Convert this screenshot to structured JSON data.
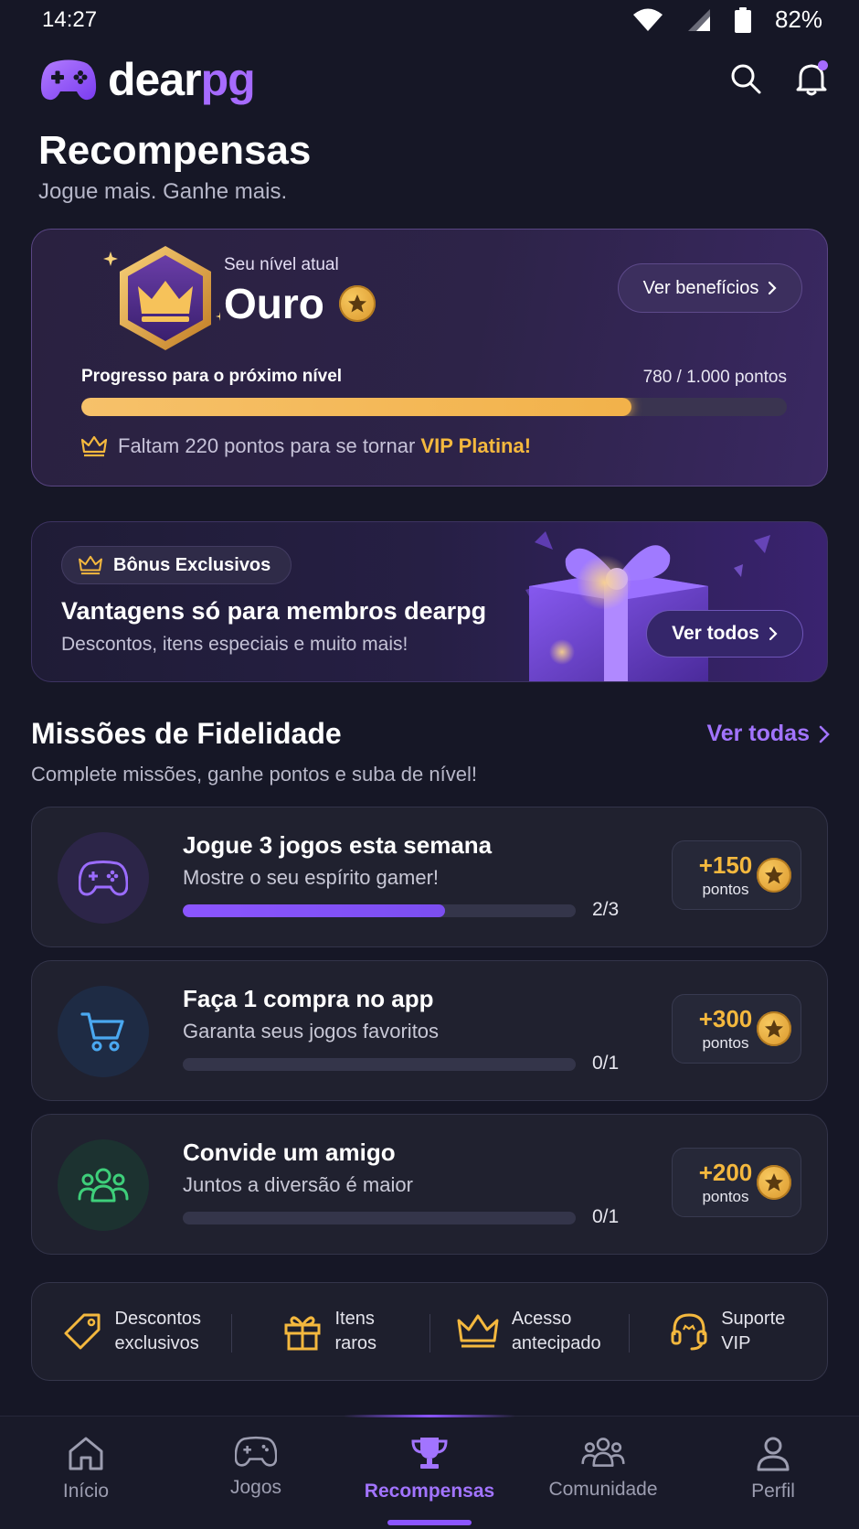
{
  "status_bar": {
    "time": "14:27",
    "battery": "82%"
  },
  "brand": {
    "name_part1": "dear",
    "name_part2": "pg"
  },
  "page": {
    "title": "Recompensas",
    "subtitle": "Jogue mais. Ganhe mais."
  },
  "level": {
    "label": "Seu nível atual",
    "name": "Ouro",
    "benefits_button": "Ver benefícios",
    "progress_label": "Progresso para o próximo nível",
    "progress_points": "780 / 1.000 pontos",
    "progress_fraction": 0.78,
    "remaining_text": "Faltam 220 pontos para se tornar ",
    "remaining_highlight": "VIP Platina!"
  },
  "bonus": {
    "tag": "Bônus Exclusivos",
    "title": "Vantagens só para membros dearpg",
    "subtitle": "Descontos, itens especiais e muito mais!",
    "button": "Ver todos"
  },
  "missions": {
    "title": "Missões de Fidelidade",
    "link": "Ver todas",
    "subtitle": "Complete missões, ganhe pontos e suba de nível!",
    "items": [
      {
        "title": "Jogue 3 jogos esta semana",
        "subtitle": "Mostre o seu espírito gamer!",
        "count": "2/3",
        "progress": 0.6667,
        "points": "+150",
        "points_label": "pontos",
        "icon": "gamepad-icon",
        "color": "#8b5cf6"
      },
      {
        "title": "Faça 1 compra no app",
        "subtitle": "Garanta seus jogos favoritos",
        "count": "0/1",
        "progress": 0,
        "points": "+300",
        "points_label": "pontos",
        "icon": "cart-icon",
        "color": "#4aa8f0"
      },
      {
        "title": "Convide um amigo",
        "subtitle": "Juntos a diversão é maior",
        "count": "0/1",
        "progress": 0,
        "points": "+200",
        "points_label": "pontos",
        "icon": "friends-icon",
        "color": "#3ecf7a"
      }
    ]
  },
  "perks": [
    {
      "line1": "Descontos",
      "line2": "exclusivos",
      "icon": "tag-icon"
    },
    {
      "line1": "Itens",
      "line2": "raros",
      "icon": "gift-icon"
    },
    {
      "line1": "Acesso",
      "line2": "antecipado",
      "icon": "crown-icon"
    },
    {
      "line1": "Suporte",
      "line2": "VIP",
      "icon": "headset-icon"
    }
  ],
  "tabs": [
    {
      "label": "Início",
      "icon": "home-icon"
    },
    {
      "label": "Jogos",
      "icon": "gamepad-icon"
    },
    {
      "label": "Recompensas",
      "icon": "trophy-icon",
      "active": true
    },
    {
      "label": "Comunidade",
      "icon": "community-icon"
    },
    {
      "label": "Perfil",
      "icon": "user-icon"
    }
  ],
  "colors": {
    "accent": "#a66bff",
    "gold": "#f4b83e",
    "background": "#161726"
  }
}
